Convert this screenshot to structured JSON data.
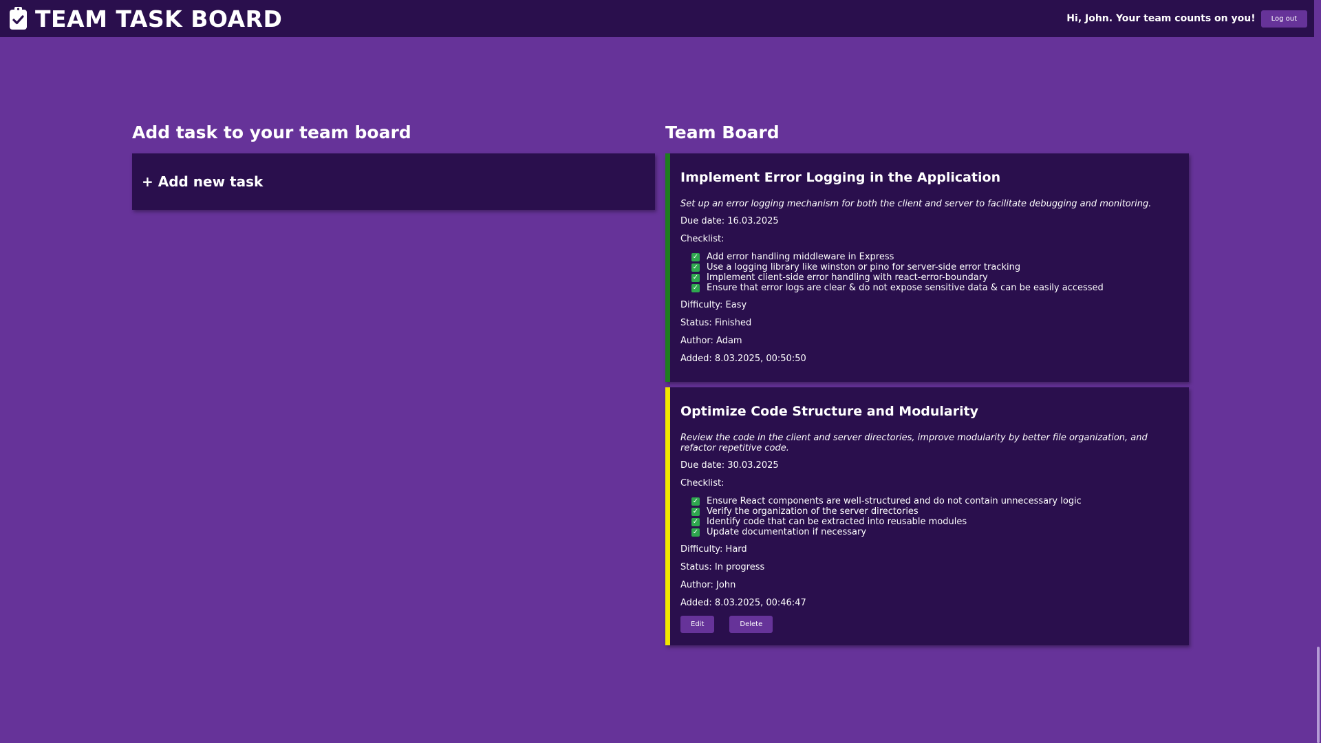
{
  "header": {
    "title": "TEAM TASK BOARD",
    "logo_icon": "clipboard-check-icon",
    "greeting": "Hi, John. Your team counts on you!",
    "logout_label": "Log out"
  },
  "left": {
    "heading": "Add task to your team board",
    "add_task_label": "+ Add new task"
  },
  "board": {
    "heading": "Team Board",
    "tasks": [
      {
        "title": "Implement Error Logging in the Application",
        "description": "Set up an error logging mechanism for both the client and server to facilitate debugging and monitoring.",
        "due_date": "Due date: 16.03.2025",
        "checklist_label": "Checklist:",
        "checklist": [
          "Add error handling middleware in Express",
          "Use a logging library like winston or pino for server-side error tracking",
          "Implement client-side error handling with react-error-boundary",
          "Ensure that error logs are clear & do not expose sensitive data & can be easily accessed"
        ],
        "difficulty": "Difficulty: Easy",
        "status": "Status: Finished",
        "author": "Author: Adam",
        "added": "Added: 8.03.2025, 00:50:50",
        "accent_color": "#1e7e1e"
      },
      {
        "title": "Optimize Code Structure and Modularity",
        "description": "Review the code in the client and server directories, improve modularity by better file organization, and refactor repetitive code.",
        "due_date": "Due date: 30.03.2025",
        "checklist_label": "Checklist:",
        "checklist": [
          "Ensure React components are well-structured and do not contain unnecessary logic",
          "Verify the organization of the server directories",
          "Identify code that can be extracted into reusable modules",
          "Update documentation if necessary"
        ],
        "difficulty": "Difficulty: Hard",
        "status": "Status: In progress",
        "author": "Author: John",
        "added": "Added: 8.03.2025, 00:46:47",
        "accent_color": "#f2e600",
        "edit_label": "Edit",
        "delete_label": "Delete"
      }
    ]
  },
  "colors": {
    "background": "#663399",
    "panel": "#2a0f4d",
    "button": "#663399",
    "checkbox": "#2fa84f"
  }
}
